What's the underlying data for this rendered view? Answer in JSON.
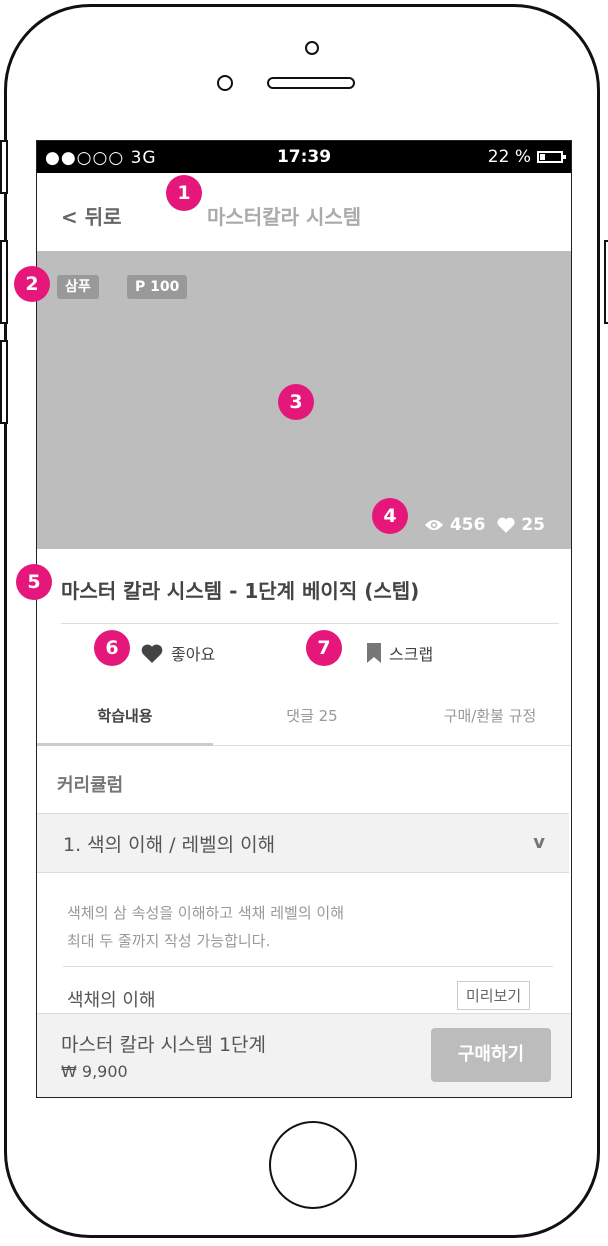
{
  "status_bar": {
    "signal": "●●○○○  3G",
    "time": "17:39",
    "battery": "22 %"
  },
  "nav": {
    "back_label": "< 뒤로",
    "title": "마스터칼라 시스템"
  },
  "hero": {
    "tags": [
      "삼푸",
      "P 100"
    ],
    "views": "456",
    "likes": "25"
  },
  "course": {
    "title": "마스터 칼라 시스템 - 1단계 베이직 (스텝)"
  },
  "actions": {
    "like_label": "좋아요",
    "scrap_label": "스크랩"
  },
  "tabs": [
    {
      "label": "학습내용",
      "active": true
    },
    {
      "label": "댓글 25",
      "active": false
    },
    {
      "label": "구매/환불 규정",
      "active": false
    }
  ],
  "curriculum": {
    "heading": "커리큘럼",
    "section_label": "1.  색의 이해 / 레벨의 이해",
    "section_chevron": "v",
    "description": [
      "색체의 삼 속성을 이해하고 색채 레벨의 이해",
      "최대 두 줄까지 작성 가능합니다."
    ],
    "lesson_title": "색채의 이해",
    "preview_label": "미리보기"
  },
  "purchase": {
    "product": "마스터 칼라 시스템 1단계",
    "price": "₩ 9,900",
    "buy_label": "구매하기"
  },
  "annotations": [
    "1",
    "2",
    "3",
    "4",
    "5",
    "6",
    "7"
  ],
  "colors": {
    "annotation": "#e6177a",
    "hero_bg": "#bdbdbd",
    "tag_bg": "#999999"
  }
}
